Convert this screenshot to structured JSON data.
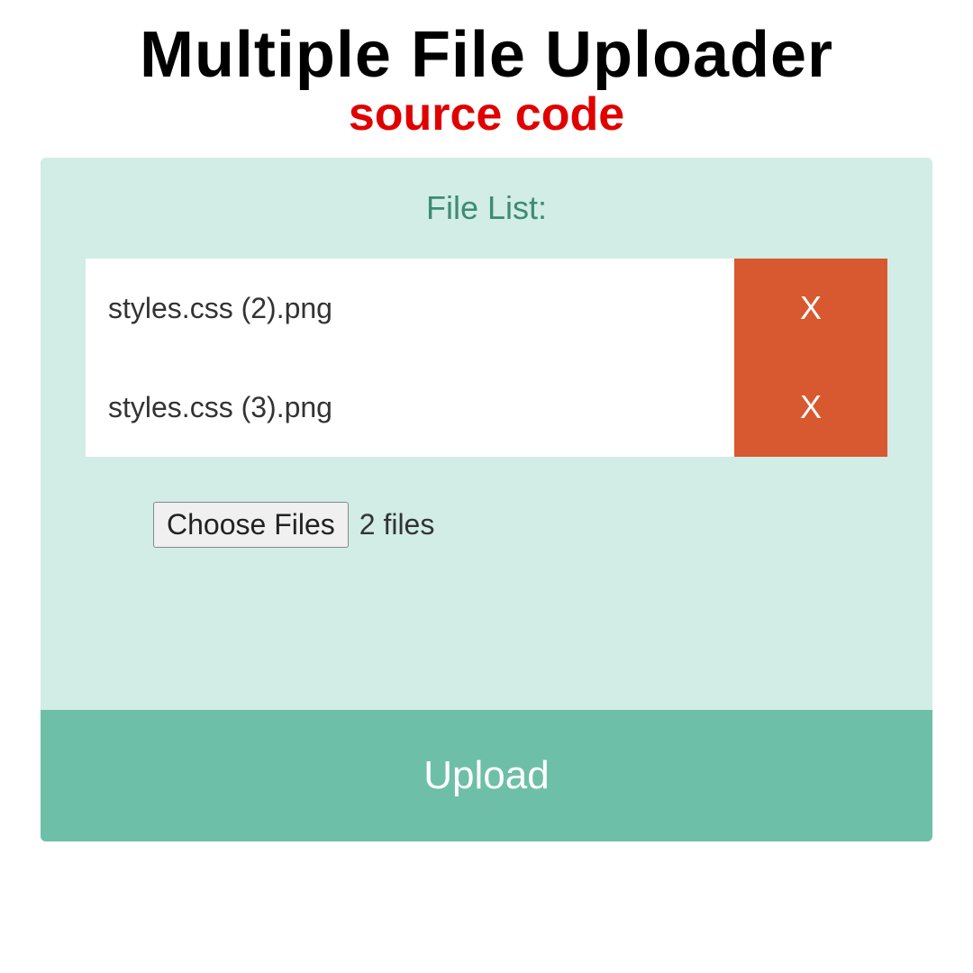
{
  "header": {
    "title": "Multiple File Uploader",
    "subtitle": "source code"
  },
  "uploader": {
    "list_title": "File List:",
    "files": [
      {
        "name": "styles.css (2).png",
        "remove_label": "X"
      },
      {
        "name": "styles.css (3).png",
        "remove_label": "X"
      }
    ],
    "choose_label": "Choose Files",
    "file_count_text": "2 files",
    "upload_label": "Upload"
  }
}
